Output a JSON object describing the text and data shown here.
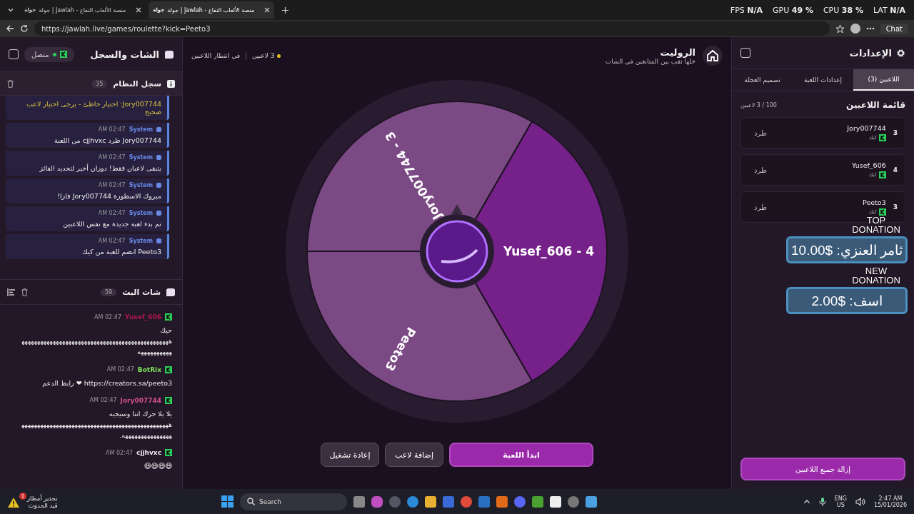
{
  "browser": {
    "tabs": [
      {
        "favicon": "جولة",
        "title": "جولة | Jawlah - منصة الألعاب التفاع",
        "selected": true
      },
      {
        "favicon": "جولة",
        "title": "جولة | Jawlah - منصة الألعاب التفاع",
        "selected": false
      }
    ],
    "url": "https://jawlah.live/games/roulette?kick=Peeto3",
    "chat_button": "Chat"
  },
  "stats": [
    "LAT **N/A**",
    "CPU **38 %**",
    "GPU **49 %**",
    "FPS **N/A**"
  ],
  "chat_panel": {
    "title": "الشات والسجل",
    "status": "متصل",
    "system_log": {
      "title": "سجل النظام",
      "count": "35",
      "entries": [
        {
          "kind": "warning",
          "text": "Jory007744: اختيار خاطئ - يرجى اختيار لاعب صحيح"
        },
        {
          "kind": "system",
          "sender": "System",
          "time": "AM 02:47",
          "text": "Jory007744 طرد cjjhvxc من اللعبة"
        },
        {
          "kind": "system",
          "sender": "System",
          "time": "AM 02:47",
          "text": "يتبقى لاعبان فقط! دوران أخير لتحديد الفائز"
        },
        {
          "kind": "system",
          "sender": "System",
          "time": "AM 02:47",
          "text": "مبروك الاسطورة Jory007744 فازا!"
        },
        {
          "kind": "system",
          "sender": "System",
          "time": "AM 02:47",
          "text": "تم بدء لعبة جديدة مع نفس اللاعبين"
        },
        {
          "kind": "system",
          "sender": "System",
          "time": "AM 02:47",
          "text": "Peeto3 انضم للعبة من كيك"
        }
      ]
    },
    "stream_chat": {
      "title": "شات البث",
      "count": "59",
      "messages": [
        {
          "user": "Yusef_606",
          "color": "#b0164a",
          "time": "AM 02:47",
          "text": "حيك ههههههههههههههههههههههههههههههههههههههههههههههههههههههههههه"
        },
        {
          "user": "BotRix",
          "color": "#7ee05a",
          "time": "AM 02:47",
          "text": "https://creators.sa/peeto3 ❤ رابط الدعم"
        },
        {
          "user": "Jory007744",
          "color": "#d0508e",
          "time": "AM 02:47",
          "text": "يلا يلا حرك انتا وسيجيه هههههههههههههههههههههههههههههههههههههههههههههههههههههههههههههههه."
        },
        {
          "user": "cjjhvxc",
          "color": "#e8e4ee",
          "time": "AM 02:47",
          "text": "😆😆😆😆"
        }
      ]
    }
  },
  "game": {
    "title": "الروليت",
    "subtitle": "خلها تقب بين المتابعين في الشات",
    "players_count": "3 لاعبين",
    "state": "في انتظار اللاعبين",
    "wheel": [
      {
        "label": "Jory007744 - 3",
        "color": "#7b4a84"
      },
      {
        "label": "Yusef_606 - 4",
        "color": "#76208a"
      },
      {
        "label": "Peeto3",
        "color": "#7b4a84"
      }
    ],
    "buttons": [
      {
        "label": "ابدأ اللعبة",
        "kind": "primary"
      },
      {
        "label": "إضافة لاعب",
        "kind": "secondary"
      },
      {
        "label": "إعادة تشغيل",
        "kind": "secondary"
      }
    ]
  },
  "settings": {
    "title": "الإعدادات",
    "tabs": [
      {
        "label": "اللاعبين (3)",
        "selected": true
      },
      {
        "label": "إعدادات اللعبة",
        "selected": false
      },
      {
        "label": "تصميم العجلة",
        "selected": false
      }
    ],
    "list_title": "قائمة اللاعبين",
    "capacity": "100 / 3 لاعبين",
    "players": [
      {
        "number": "3",
        "name": "Jory007744",
        "platform": "كيك",
        "action": "طرد"
      },
      {
        "number": "4",
        "name": "Yusef_606",
        "platform": "كيك",
        "action": "طرد"
      },
      {
        "number": "3",
        "name": "Peeto3",
        "platform": "كيك",
        "action": "طرد"
      }
    ],
    "clear_button": "إزالة جميع اللاعبين"
  },
  "donations": [
    {
      "heading_1": "TOP",
      "heading_2": "DONATION",
      "text": "ثامر العنزي: $10.00"
    },
    {
      "heading_1": "NEW",
      "heading_2": "DONATION",
      "text": "اسف: $2.00"
    }
  ],
  "taskbar": {
    "weather_title": "تحذير أمطار",
    "weather_sub": "قيد الحدوث",
    "weather_badge": "1",
    "search": "Search",
    "lang_1": "ENG",
    "lang_2": "US",
    "time": "2:47 AM",
    "date": "15/01/2026"
  }
}
